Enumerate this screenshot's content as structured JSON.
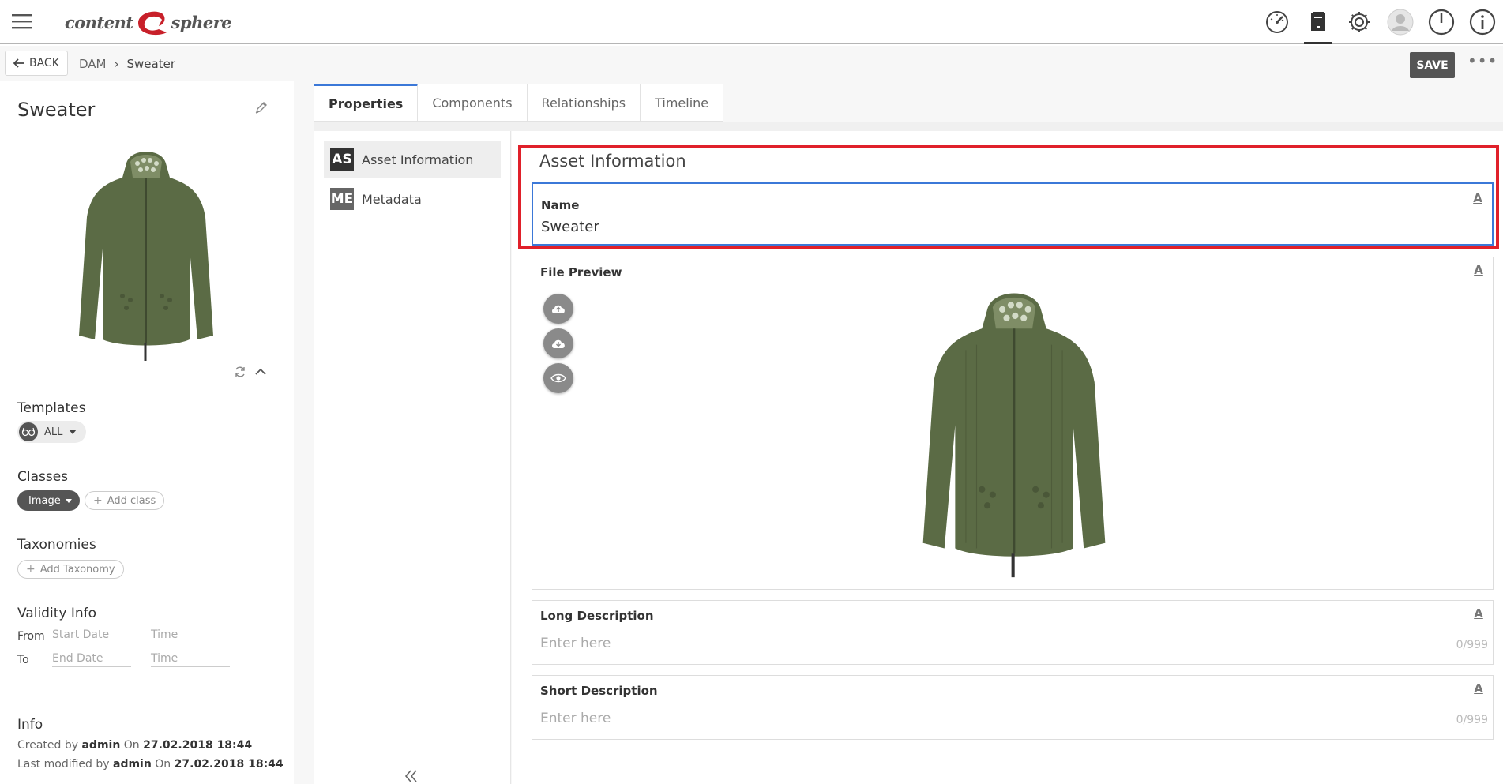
{
  "header": {
    "logo_left": "content",
    "logo_right": "sphere",
    "icons": [
      "menu-icon",
      "dashboard-icon",
      "archive-icon",
      "gear-icon",
      "user-avatar-icon",
      "power-icon",
      "info-icon"
    ]
  },
  "breadcrumb": {
    "back_label": "BACK",
    "items": [
      "DAM",
      "Sweater"
    ],
    "save_label": "SAVE",
    "more_label": "•••"
  },
  "left_panel": {
    "title": "Sweater",
    "templates_label": "Templates",
    "templates_value": "ALL",
    "classes_label": "Classes",
    "class_value": "Image",
    "add_class_label": "Add class",
    "taxonomies_label": "Taxonomies",
    "add_taxonomy_label": "Add Taxonomy",
    "validity_label": "Validity Info",
    "from_label": "From",
    "to_label": "To",
    "start_date_placeholder": "Start Date",
    "end_date_placeholder": "End Date",
    "time_placeholder": "Time",
    "info_label": "Info",
    "created_prefix": "Created by",
    "created_by": "admin",
    "created_on_prefix": "On",
    "created_on": "27.02.2018 18:44",
    "modified_prefix": "Last modified by",
    "modified_by": "admin",
    "modified_on_prefix": "On",
    "modified_on": "27.02.2018 18:44"
  },
  "tabs": [
    {
      "label": "Properties",
      "active": true
    },
    {
      "label": "Components",
      "active": false
    },
    {
      "label": "Relationships",
      "active": false
    },
    {
      "label": "Timeline",
      "active": false
    }
  ],
  "nav": [
    {
      "badge": "AS",
      "label": "Asset Information",
      "active": true
    },
    {
      "badge": "ME",
      "label": "Metadata",
      "active": false
    }
  ],
  "form": {
    "section_title": "Asset Information",
    "name_label": "Name",
    "name_value": "Sweater",
    "file_preview_label": "File Preview",
    "long_desc_label": "Long Description",
    "long_desc_placeholder": "Enter here",
    "long_desc_count": "0/999",
    "short_desc_label": "Short Description",
    "short_desc_placeholder": "Enter here",
    "short_desc_count": "0/999",
    "field_type_glyph": "A"
  },
  "colors": {
    "accent": "#3b78d8",
    "highlight": "#e0202a",
    "logo_red": "#c8202a",
    "sweater": "#5b6b45"
  }
}
